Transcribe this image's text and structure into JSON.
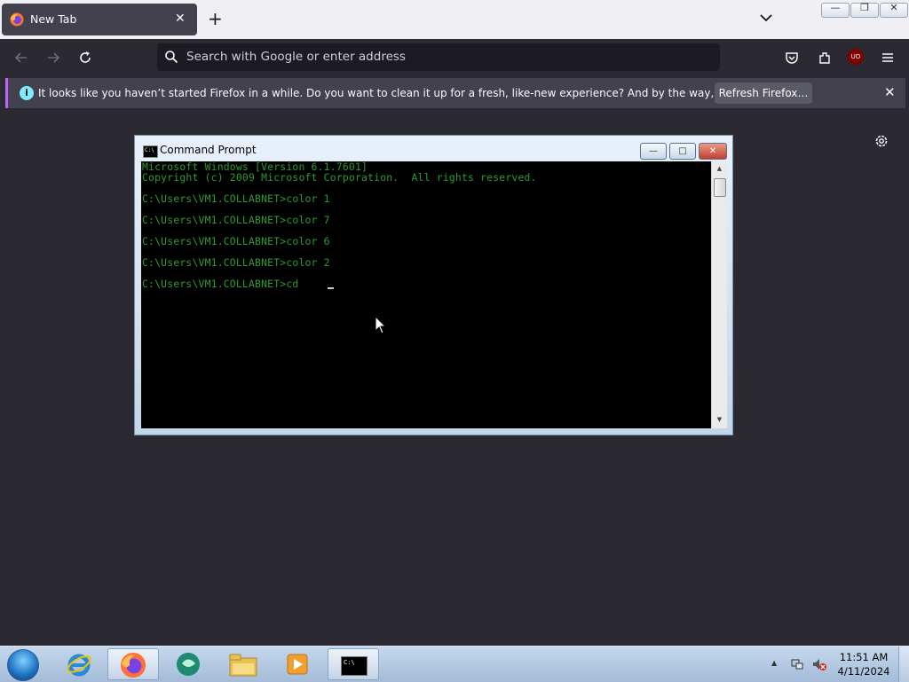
{
  "browser": {
    "tab": {
      "title": "New Tab"
    },
    "new_tab_label": "+",
    "window_controls": {
      "minimize": "—",
      "maximize": "❐",
      "close": "✕"
    },
    "urlbar": {
      "placeholder": "Search with Google or enter address"
    },
    "extension_badge": "UO",
    "notification": {
      "message": "It looks like you haven’t started Firefox in a while. Do you want to clean it up for a fresh, like-new experience? And by the way, welcome back!",
      "button_label": "Refresh Firefox…",
      "close": "✕",
      "accent": "#c060ff"
    },
    "colors": {
      "bg": "#2b2a33",
      "tabstrip": "#f0f0f4",
      "tab": "#42414d",
      "urlbar": "#1c1b22"
    }
  },
  "cmd": {
    "title": "Command Prompt",
    "icon_text": "C:\\",
    "controls": {
      "minimize": "—",
      "maximize": "□",
      "close": "✕"
    },
    "lines": [
      "Microsoft Windows [Version 6.1.7601]",
      "Copyright (c) 2009 Microsoft Corporation.  All rights reserved.",
      "",
      "C:\\Users\\VM1.COLLABNET>color 1",
      "",
      "C:\\Users\\VM1.COLLABNET>color 7",
      "",
      "C:\\Users\\VM1.COLLABNET>color 6",
      "",
      "C:\\Users\\VM1.COLLABNET>color 2",
      "",
      "C:\\Users\\VM1.COLLABNET>cd "
    ],
    "text_color": "#2e9a32",
    "scroll_up": "▲",
    "scroll_down": "▼"
  },
  "taskbar": {
    "items": [
      "internet-explorer",
      "firefox",
      "chat",
      "file-explorer",
      "media-player",
      "command-prompt"
    ],
    "clock": {
      "time": "11:51 AM",
      "date": "4/11/2024"
    },
    "tray_arrow": "▲"
  }
}
